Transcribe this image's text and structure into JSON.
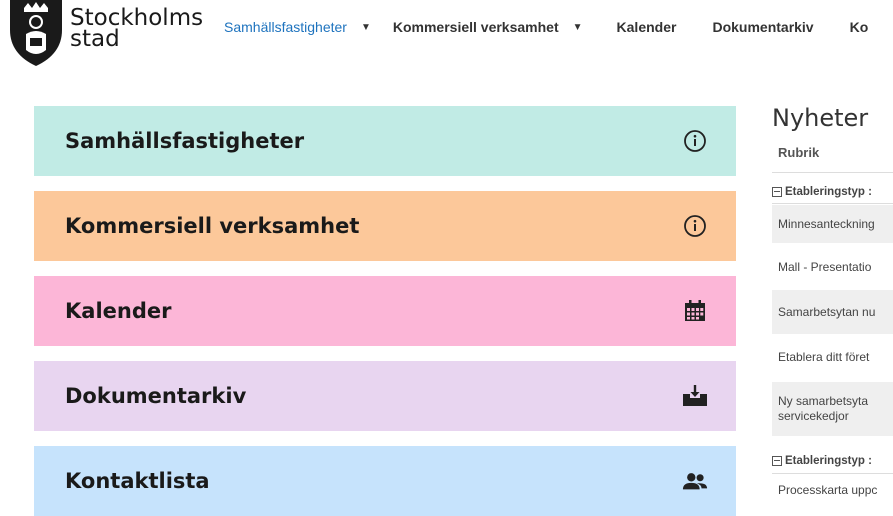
{
  "logo": {
    "line1": "Stockholms",
    "line2": "stad"
  },
  "nav": [
    {
      "label": "Samhällsfastigheter",
      "active": true,
      "dropdown": true
    },
    {
      "label": "Kommersiell verksamhet",
      "active": false,
      "dropdown": true
    },
    {
      "label": "Kalender",
      "active": false,
      "dropdown": false
    },
    {
      "label": "Dokumentarkiv",
      "active": false,
      "dropdown": false
    },
    {
      "label": "Ko",
      "active": false,
      "dropdown": false
    }
  ],
  "tiles": [
    {
      "label": "Samhällsfastigheter",
      "color": "#c1ebe5",
      "icon": "info-icon"
    },
    {
      "label": "Kommersiell verksamhet",
      "color": "#fcc89a",
      "icon": "info-icon"
    },
    {
      "label": "Kalender",
      "color": "#fcb6d7",
      "icon": "calendar-icon"
    },
    {
      "label": "Dokumentarkiv",
      "color": "#e8d5f0",
      "icon": "inbox-download-icon"
    },
    {
      "label": "Kontaktlista",
      "color": "#c6e3fc",
      "icon": "people-icon"
    }
  ],
  "news": {
    "title": "Nyheter",
    "column": "Rubrik",
    "group1": "Etableringstyp :",
    "rows": [
      "Minnesanteckning",
      "Mall - Presentatio",
      "Samarbetsytan nu",
      "Etablera ditt föret",
      "Ny samarbetsyta servicekedjor"
    ],
    "row5_line1": "Ny samarbetsyta",
    "row5_line2": "servicekedjor",
    "group2": "Etableringstyp :",
    "row6": "Processkarta uppc"
  }
}
